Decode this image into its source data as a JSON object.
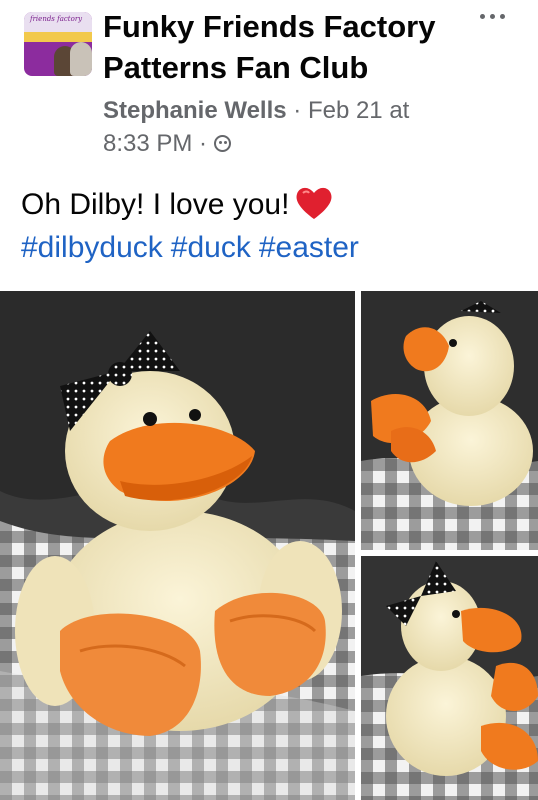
{
  "group": {
    "name_line1": "Funky Friends Factory",
    "name_line2": "Patterns Fan Club",
    "avatar_text": "Funky Friends Factory Patterns Fan Club"
  },
  "post": {
    "author": "Stephanie Wells",
    "separator": " · ",
    "date_line1": "Feb 21 at",
    "date_line2": "8:33 PM",
    "text": "Oh Dilby! I love you!",
    "hashtags": [
      "#dilbyduck",
      "#duck",
      "#easter"
    ]
  },
  "icons": {
    "more": "more-options-icon",
    "audience": "globe-icon",
    "emoji": "red-heart-emoji"
  },
  "photos": [
    {
      "name": "main-photo"
    },
    {
      "name": "side-photo-top"
    },
    {
      "name": "side-photo-bottom"
    }
  ],
  "colors": {
    "link": "#1f63c4",
    "meta": "#65676b",
    "text": "#050505",
    "heart": "#e0202f"
  }
}
